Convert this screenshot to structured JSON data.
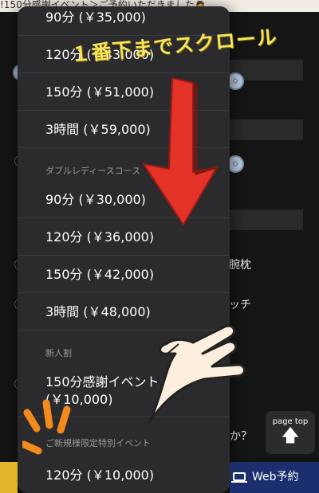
{
  "header": {
    "marquee": "!150分感謝イベント＞ご予約いただきました🙇"
  },
  "overlay": {
    "annotation_text": "１番下までスクロール"
  },
  "dropdown": {
    "options": [
      {
        "label": "90分 (￥35,000)"
      },
      {
        "label": "120分 (￥43,000)"
      },
      {
        "label": "150分 (￥51,000)"
      },
      {
        "label": "3時間 (￥59,000)"
      }
    ],
    "group_double": {
      "title": "ダブルレディースコース",
      "options": [
        {
          "label": "90分 (￥30,000)"
        },
        {
          "label": "120分 (￥36,000)"
        },
        {
          "label": "150分 (￥42,000)"
        },
        {
          "label": "3時間 (￥48,000)"
        }
      ]
    },
    "group_new": {
      "title": "新人割",
      "options": [
        {
          "line1": "150分感謝イベント",
          "line2": "(￥10,000)"
        }
      ]
    },
    "group_special": {
      "title": "ご新規様限定特別イベント",
      "options": [
        {
          "label": "120分 (￥10,000)"
        }
      ]
    }
  },
  "background": {
    "snippet_pillow": "腕枕",
    "snippet_touch": "ッチ",
    "snippet_question": "か？"
  },
  "page_top": {
    "label": "page top",
    "arrow": "🡅"
  },
  "bottom_bar": {
    "web_reservation": "Web予約"
  },
  "colors": {
    "annotation_yellow": "#f7e35a",
    "arrow_red": "#e53228",
    "bottom_yellow": "#e3b629",
    "bottom_navy": "#1b2f6e"
  }
}
